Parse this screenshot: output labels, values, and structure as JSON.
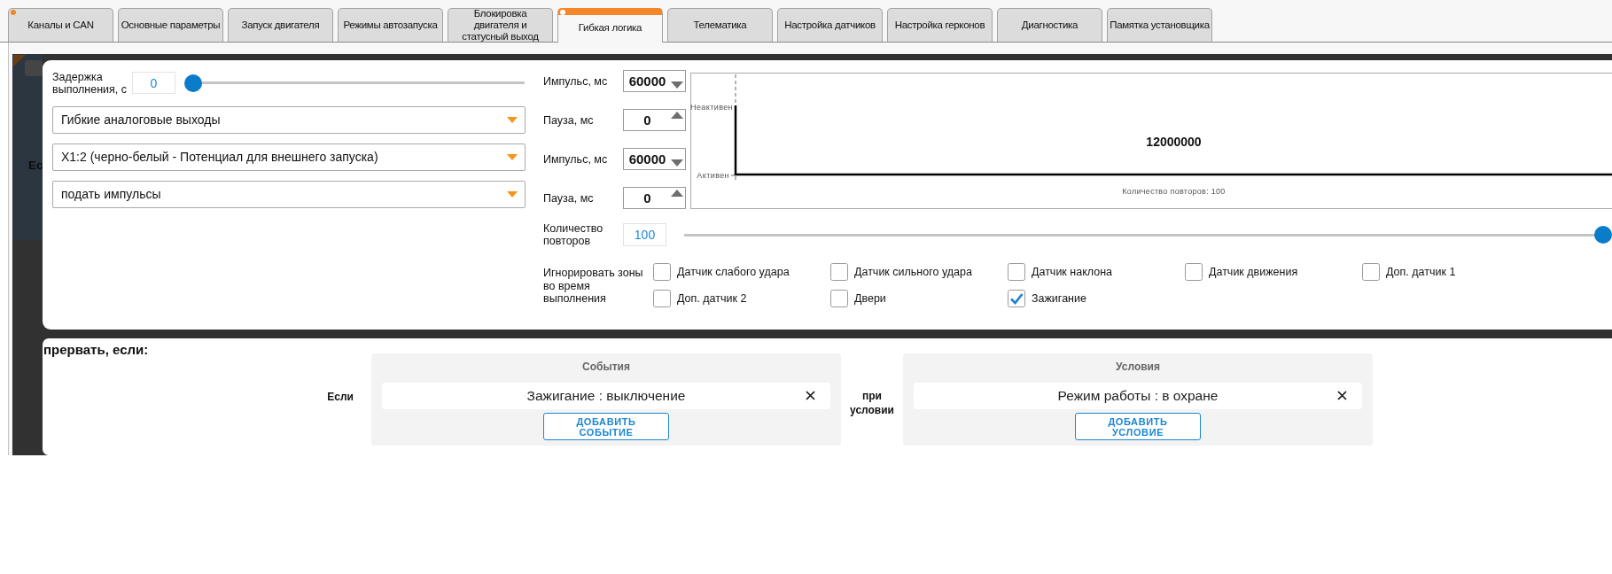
{
  "tabs": [
    {
      "label": "Каналы и CAN",
      "selected": false,
      "modified": true
    },
    {
      "label": "Основные параметры",
      "selected": false,
      "modified": false
    },
    {
      "label": "Запуск двигателя",
      "selected": false,
      "modified": false
    },
    {
      "label": "Режимы автозапуска",
      "selected": false,
      "modified": false
    },
    {
      "label": "Блокировка двигателя и статусный выход",
      "selected": false,
      "modified": false
    },
    {
      "label": "Гибкая логика",
      "selected": true,
      "modified": true
    },
    {
      "label": "Телематика",
      "selected": false,
      "modified": false
    },
    {
      "label": "Настройка датчиков",
      "selected": false,
      "modified": false
    },
    {
      "label": "Настройка герконов",
      "selected": false,
      "modified": false
    },
    {
      "label": "Диагностика",
      "selected": false,
      "modified": false
    },
    {
      "label": "Памятка установщика",
      "selected": false,
      "modified": false
    }
  ],
  "backdrop": {
    "dimmed_text": "Ес"
  },
  "action": {
    "delay": {
      "label": "Задержка выполнения, с",
      "value": "0",
      "level": 0
    },
    "selects": [
      {
        "value": "Гибкие аналоговые выходы"
      },
      {
        "value": "X1:2 (черно-белый - Потенциал для внешнего запуска)"
      },
      {
        "value": "подать импульсы"
      }
    ],
    "timing": [
      {
        "label": "Импульс, мс",
        "value": "60000",
        "kind": "down"
      },
      {
        "label": "Пауза, мс",
        "value": "0",
        "kind": "up"
      },
      {
        "label": "Импульс, мс",
        "value": "60000",
        "kind": "down"
      },
      {
        "label": "Пауза, мс",
        "value": "0",
        "kind": "up"
      }
    ],
    "diagram": {
      "inactive_label": "Неактивен",
      "active_label": "Активен",
      "duration": "12000000",
      "caption": "Количество повторов: 100"
    },
    "repeats": {
      "label": "Количество повторов",
      "value": "100",
      "level": 1
    },
    "ignore_zones": {
      "label": "Игнорировать зоны во время выполнения",
      "options": [
        {
          "label": "Датчик слабого удара",
          "checked": false
        },
        {
          "label": "Датчик сильного удара",
          "checked": false
        },
        {
          "label": "Датчик наклона",
          "checked": false
        },
        {
          "label": "Датчик движения",
          "checked": false
        },
        {
          "label": "Доп. датчик 1",
          "checked": false
        },
        {
          "label": "Доп. датчик 2",
          "checked": false
        },
        {
          "label": "Двери",
          "checked": false
        },
        {
          "label": "Зажигание",
          "checked": true
        }
      ]
    }
  },
  "interrupt": {
    "title": "прервать, если:",
    "if_label": "Если",
    "events": {
      "title": "События",
      "items": [
        {
          "text": "Зажигание : выключение"
        }
      ],
      "button": "ДОБАВИТЬ СОБЫТИЕ"
    },
    "condition_label": "при условии",
    "conditions": {
      "title": "Условия",
      "items": [
        {
          "text": "Режим работы : в охране"
        }
      ],
      "button": "ДОБАВИТЬ УСЛОВИЕ"
    }
  }
}
